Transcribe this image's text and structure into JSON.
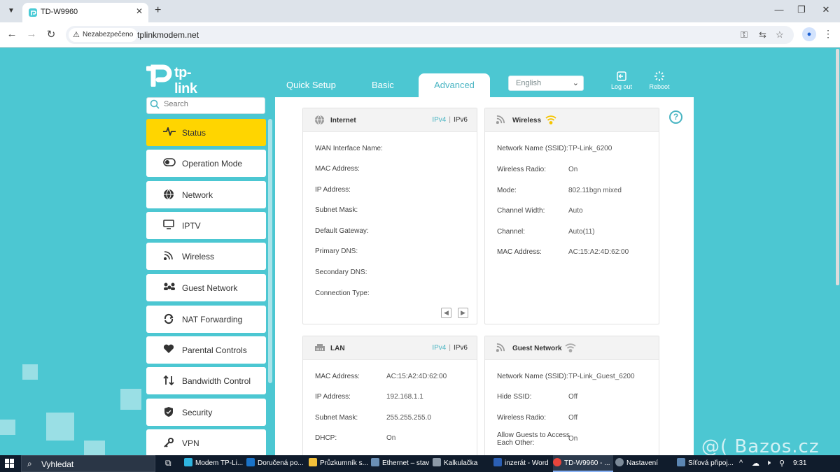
{
  "browser": {
    "tab_title": "TD-W9960",
    "security_label": "Nezabezpečeno",
    "url": "tplinkmodem.net"
  },
  "router": {
    "logo_text": "tp-link",
    "top_tabs": [
      "Quick Setup",
      "Basic",
      "Advanced"
    ],
    "language": "English",
    "logout_label": "Log out",
    "reboot_label": "Reboot",
    "search_placeholder": "Search"
  },
  "sidebar": {
    "items": [
      {
        "label": "Status",
        "icon": "status-pulse-icon",
        "active": true
      },
      {
        "label": "Operation Mode",
        "icon": "toggle-icon"
      },
      {
        "label": "Network",
        "icon": "globe-icon"
      },
      {
        "label": "IPTV",
        "icon": "monitor-icon"
      },
      {
        "label": "Wireless",
        "icon": "wireless-icon"
      },
      {
        "label": "Guest Network",
        "icon": "guests-icon"
      },
      {
        "label": "NAT Forwarding",
        "icon": "nat-icon"
      },
      {
        "label": "Parental Controls",
        "icon": "heart-icon"
      },
      {
        "label": "Bandwidth Control",
        "icon": "bandwidth-icon"
      },
      {
        "label": "Security",
        "icon": "shield-icon"
      },
      {
        "label": "VPN",
        "icon": "key-icon"
      }
    ]
  },
  "internet": {
    "title": "Internet",
    "ipv4": "IPv4",
    "ipv6": "IPv6",
    "labels": [
      "WAN Interface Name:",
      "MAC Address:",
      "IP Address:",
      "Subnet Mask:",
      "Default Gateway:",
      "Primary DNS:",
      "Secondary DNS:",
      "Connection Type:"
    ]
  },
  "wireless": {
    "title": "Wireless",
    "rows": [
      {
        "label": "Network Name (SSID):",
        "value": "TP-Link_6200"
      },
      {
        "label": "Wireless Radio:",
        "value": "On"
      },
      {
        "label": "Mode:",
        "value": "802.11bgn mixed"
      },
      {
        "label": "Channel Width:",
        "value": "Auto"
      },
      {
        "label": "Channel:",
        "value": "Auto(11)"
      },
      {
        "label": "MAC Address:",
        "value": "AC:15:A2:4D:62:00"
      }
    ]
  },
  "lan": {
    "title": "LAN",
    "ipv4": "IPv4",
    "ipv6": "IPv6",
    "rows": [
      {
        "label": "MAC Address:",
        "value": "AC:15:A2:4D:62:00"
      },
      {
        "label": "IP Address:",
        "value": "192.168.1.1"
      },
      {
        "label": "Subnet Mask:",
        "value": "255.255.255.0"
      },
      {
        "label": "DHCP:",
        "value": "On"
      }
    ]
  },
  "guest": {
    "title": "Guest Network",
    "rows": [
      {
        "label": "Network Name (SSID):",
        "value": "TP-Link_Guest_6200"
      },
      {
        "label": "Hide SSID:",
        "value": "Off"
      },
      {
        "label": "Wireless Radio:",
        "value": "Off"
      },
      {
        "label": "Allow Guests to Access Each Other:",
        "value": "On"
      }
    ]
  },
  "watermark": "@( Bazos.cz",
  "taskbar": {
    "search": "Vyhledat",
    "apps": [
      "Modem TP-Li...",
      "Doručená po...",
      "Průzkumník s...",
      "Ethernet – stav",
      "Kalkulačka",
      "inzerát - Word",
      "TD-W9960 - ...",
      "Nastavení",
      "Síťová připoj..."
    ],
    "time": "9:31"
  },
  "colors": {
    "page_bg": "#4cc7d2",
    "accent": "#4ab5c3",
    "active_menu": "#ffd500",
    "wifi_on": "#f5c400"
  }
}
